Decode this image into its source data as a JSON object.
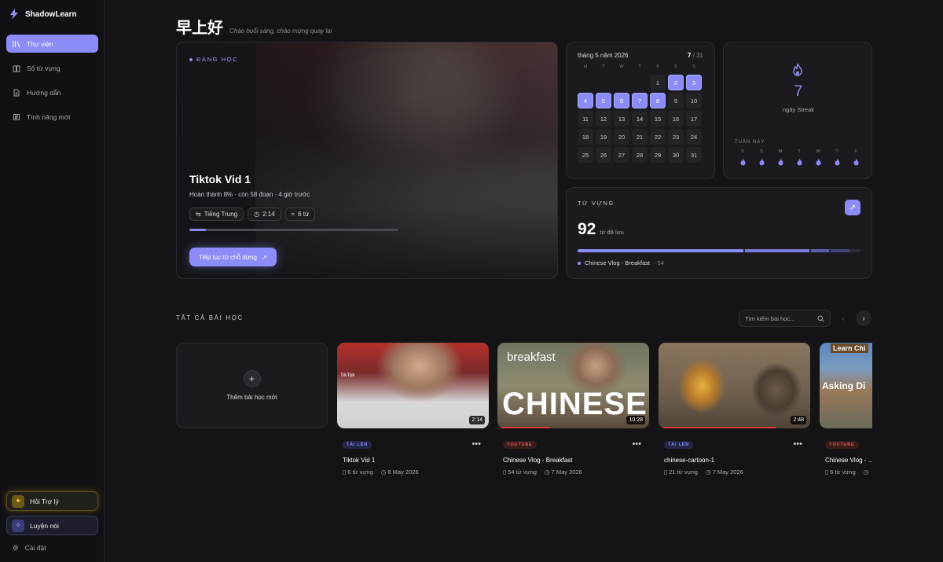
{
  "app": {
    "name": "ShadowLearn"
  },
  "sidebar": {
    "items": [
      {
        "label": "Thư viện",
        "icon": "library-icon",
        "active": true
      },
      {
        "label": "Sổ từ vựng",
        "icon": "book-icon",
        "active": false
      },
      {
        "label": "Hướng dẫn",
        "icon": "doc-icon",
        "active": false
      },
      {
        "label": "Tính năng mới",
        "icon": "news-icon",
        "active": false
      }
    ],
    "assistant_label": "Hỏi Trợ lý",
    "speaking_label": "Luyện nói",
    "settings_label": "Cài đặt"
  },
  "header": {
    "greeting": "早上好",
    "subtitle": "Chào buổi sáng, chào mừng quay lại"
  },
  "current_lesson": {
    "status_label": "ĐANG HỌC",
    "title": "Tiktok Vid 1",
    "progress_text": "Hoàn thành 8% · còn 58 đoạn · 4 giờ trước",
    "progress_fraction": 0.08,
    "chips": {
      "language": "Tiếng Trung",
      "duration": "2:14",
      "words": "6 từ"
    },
    "cta_label": "Tiếp tục từ chỗ dừng"
  },
  "calendar": {
    "month_label": "tháng 5 năm 2026",
    "done_count": "7",
    "total_days": "/ 31",
    "weekdays": [
      "H",
      "T",
      "W",
      "T",
      "F",
      "S",
      "S"
    ],
    "leading_blanks": 4,
    "days_in_month": 31,
    "active_days": [
      2,
      3,
      4,
      5,
      6,
      7,
      8
    ]
  },
  "streak": {
    "count": "7",
    "label": "ngày Streak",
    "week_label": "TUẦN NÀY",
    "week_days": [
      "S",
      "S",
      "M",
      "T",
      "W",
      "T",
      "F"
    ]
  },
  "vocab": {
    "title": "TỪ VỰNG",
    "count": "92",
    "count_label": "từ đã lưu",
    "legend_name": "Chinese Vlog - Breakfast",
    "legend_count": "· 54"
  },
  "lessons": {
    "section_title": "TẤT CẢ BÀI HỌC",
    "search_placeholder": "Tìm kiếm bài học...",
    "add_label": "Thêm bài học mới",
    "items": [
      {
        "source": "TẢI LÊN",
        "title": "Tiktok Vid 1",
        "duration": "2:14",
        "words": "6 từ vựng",
        "date": "8 May 2026",
        "thumb_text": "TikTok"
      },
      {
        "source": "YOUTUBE",
        "title": "Chinese Vlog - Breakfast",
        "duration": "10:28",
        "words": "54 từ vựng",
        "date": "7 May 2026",
        "thumb_small": "breakfast",
        "thumb_big": "CHINESE"
      },
      {
        "source": "TẢI LÊN",
        "title": "chinese-cartoon-1",
        "duration": "2:48",
        "words": "21 từ vựng",
        "date": "7 May 2026"
      },
      {
        "source": "YOUTUBE",
        "title": "Chinese Vlog - ...",
        "duration": "",
        "words": "6 từ vựng",
        "date": "",
        "thumb_top": "Learn Chi",
        "thumb_mid": "Asking Di"
      }
    ]
  },
  "colors": {
    "accent": "#8b8cf7",
    "youtube": "#e0605a",
    "gold": "#ffd24a"
  }
}
